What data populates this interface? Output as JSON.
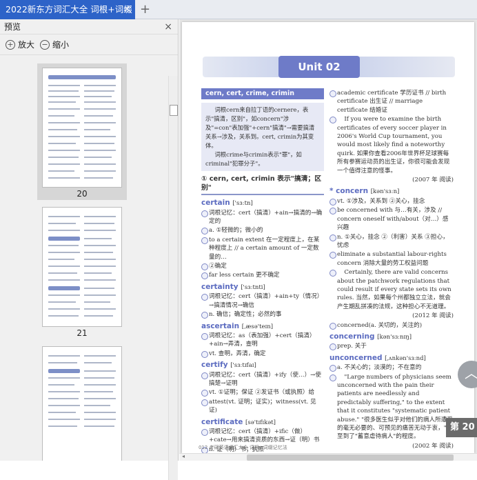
{
  "tab": {
    "title": "2022新东方词汇大全 词根+词缀",
    "close": "×",
    "new_tab": "+"
  },
  "sidebar": {
    "title": "预览",
    "close": "×",
    "zoom_in_label": "放大",
    "zoom_out_label": "缩小",
    "thumbnails": [
      {
        "label": "20",
        "selected": true
      },
      {
        "label": "21",
        "selected": false
      },
      {
        "label": "",
        "selected": false
      }
    ]
  },
  "page": {
    "unit_title": "Unit 02",
    "header_title": "cern, cert, crime, crimin",
    "header_text_1": "词根cern来自拉丁语的cernere，表示\"搞清，区别\"，如concern\"涉及\"=con\"表加强\"+cern\"搞清\"→需要搞清关系→涉及，关系到。cert, crimin为其变体。",
    "header_text_2": "词根crime与crimin表示\"罪\"，如criminal\"犯罪分子\"。",
    "section_title": "① cern, cert, crimin 表示\"搞清；区别\"",
    "left_entries": [
      {
        "word": "certain",
        "phonetic": "['sɜːtn]",
        "lines": [
          "词根记忆：cert（搞清）+ain→搞清的→确定的",
          "a. ①轻微的；微小的",
          "to a certain extent 在一定程度上，在某种程度上 // a certain amount of 一定数量的…",
          "②确定",
          "far less certain 更不确定"
        ]
      },
      {
        "word": "certainty",
        "phonetic": "['sɜːtnti]",
        "lines": [
          "词根记忆：cert（搞清）+ain+ty（情况）→搞清情况→确信",
          "n. 确信；确定性；必然的事"
        ]
      },
      {
        "word": "ascertain",
        "phonetic": "[ˌæsə'teɪn]",
        "lines": [
          "词根记忆：as（表加强）+cert（搞清）+ain→弄清，查明",
          "vt. 查明，弄清，确定"
        ]
      },
      {
        "word": "certify",
        "phonetic": "['sɜːtɪfaɪ]",
        "lines": [
          "词根记忆：cert（搞清）+ify（使…）→使搞楚→证明",
          "vt. ①证明；保证 ②发证书（或执照）给",
          "attest(vt. 证明；证实)；witness(vt. 见证)"
        ]
      },
      {
        "word": "certificate",
        "phonetic": "[sə'tɪfɪkət]",
        "lines": [
          "词根记忆：cert（搞清）+ific（做）+cate→用来搞清资质的东西→证（明）书",
          "n. 证（明）书；执照"
        ]
      }
    ],
    "right_top_lines": [
      "academic certificate 学历证书 // birth certificate 出生证 // marriage certificate 结婚证",
      "If you were to examine the birth certificates of every soccer player in 2006's World Cup tournament, you would most likely find a noteworthy quirk. 如果你查看2006年世界杯足球赛每所有参赛运动员的出生证，你很可能会发现一个值得注意的怪事。"
    ],
    "right_top_year": "(2007 年 阅读)",
    "right_entries": [
      {
        "word": "* concern",
        "phonetic": "[kən'sɜːn]",
        "lines": [
          "vt. ①涉及，关系到 ②关心，挂念",
          "be concerned with 与…有关，涉及 // concern oneself with/about（对…）感兴趣",
          "n. ①关心，挂念 ②（利害）关系 ③担心，忧虑",
          "eliminate a substantial labour-rights concern 消除大量的劳工权益问题",
          "Certainly, there are valid concerns about the patchwork regulations that could result if every state sets its own rules. 当然，如果每个州都独立立法，就会产生期乱拼凑的法规，这种担心不无道理。"
        ],
        "year": "(2012 年 阅读)",
        "extra": "concerned(a. 关切的，关注的)"
      },
      {
        "word": "concerning",
        "phonetic": "[kən'sɜːnɪŋ]",
        "lines": [
          "prep. 关于"
        ],
        "year": "",
        "extra": ""
      },
      {
        "word": "unconcerned",
        "phonetic": "[ˌʌnkən'sɜːnd]",
        "lines": [
          "a. 不关心的；淡漠的；不在意的",
          "\"Large numbers of physicians seem unconcerned with the pain their patients are needlessly and predictably suffering,\" to the extent that it constitutes \"systematic patient abuse.\" \"很多医生似乎对他们的病人所遭受的毫无必要的、可预见的痛苦无动于衷，\"乃至到了\"蓄意虐待病人\"的程度。"
        ],
        "year": "(2002 年 阅读)",
        "extra": ""
      }
    ],
    "page_number": "012",
    "footer_text": "考研英语词汇大全 词根+词缀记忆法"
  },
  "scroll_top": "︿",
  "page_indicator": "第 20"
}
